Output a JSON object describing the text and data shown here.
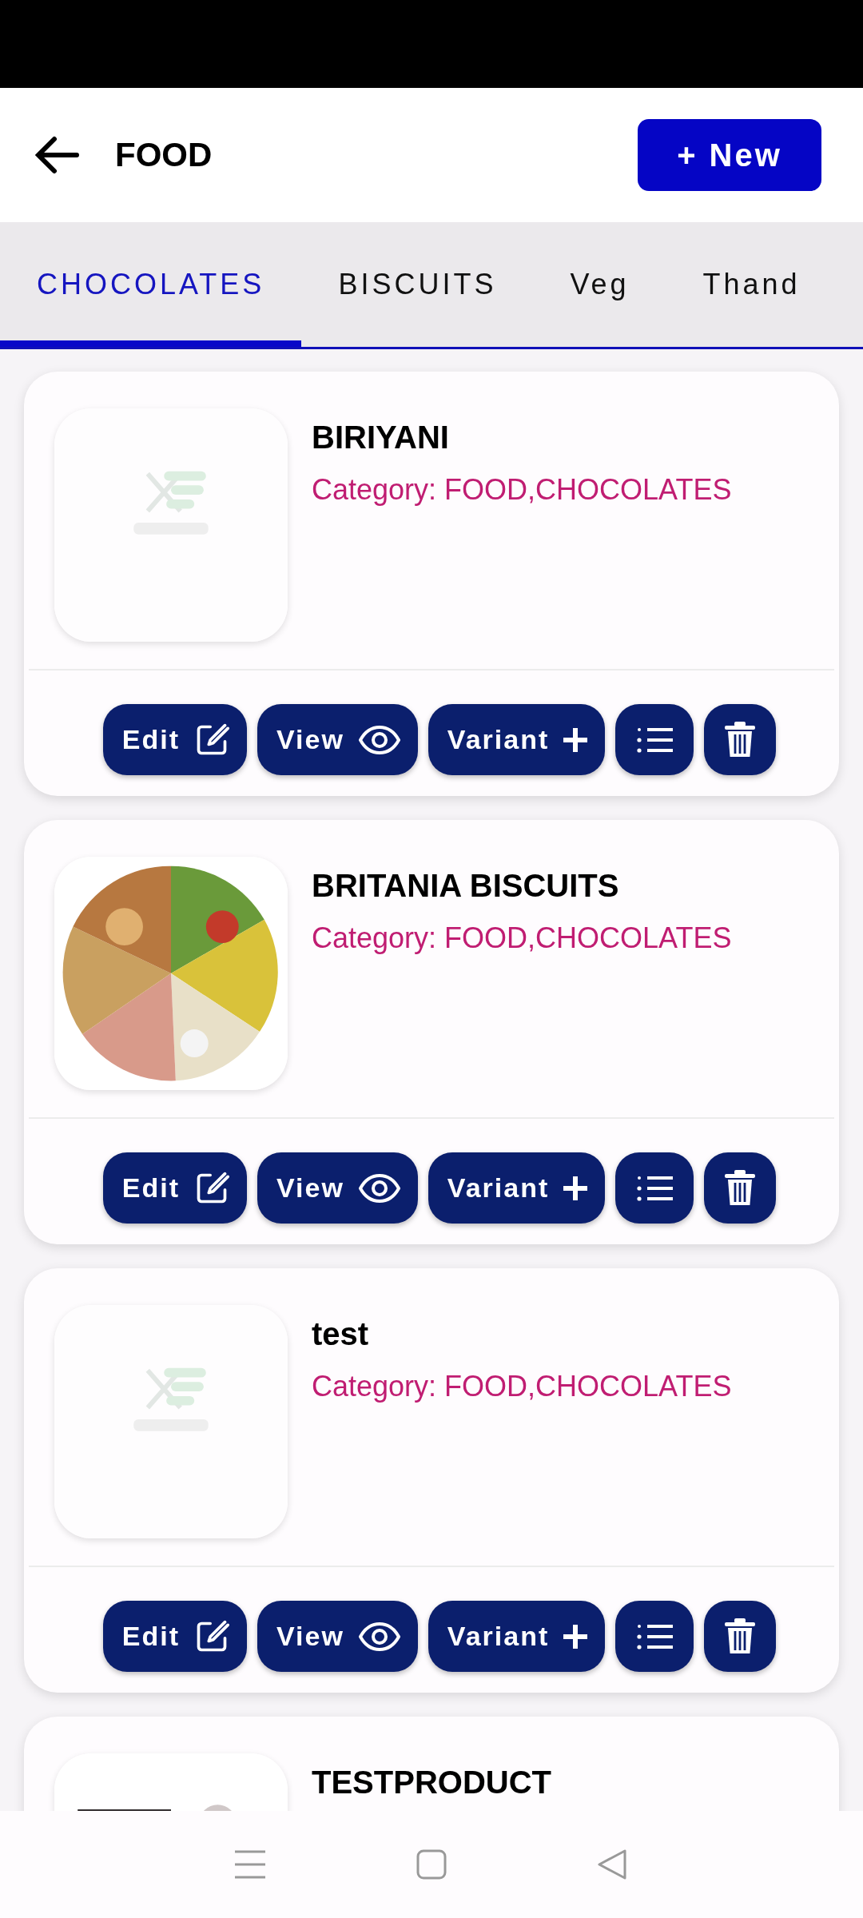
{
  "header": {
    "title": "FOOD",
    "new_button": "+ New"
  },
  "tabs": [
    {
      "label": "CHOCOLATES",
      "selected": true
    },
    {
      "label": "BISCUITS",
      "selected": false
    },
    {
      "label": "Veg",
      "selected": false
    },
    {
      "label": "Thand",
      "selected": false
    }
  ],
  "products": [
    {
      "name": "BIRIYANI",
      "category": "Category: FOOD,CHOCOLATES",
      "image": {
        "kind": "placeholder"
      },
      "actions": [
        {
          "kind": "edit",
          "label": "Edit"
        },
        {
          "kind": "view",
          "label": "View"
        },
        {
          "kind": "variant",
          "label": "Variant"
        },
        {
          "kind": "list"
        },
        {
          "kind": "delete"
        }
      ]
    },
    {
      "name": "BRITANIA BISCUITS",
      "category": "Category: FOOD,CHOCOLATES",
      "actions": [
        {
          "kind": "edit",
          "label": "Edit"
        },
        {
          "kind": "view",
          "label": "View"
        },
        {
          "kind": "variant",
          "label": "Variant"
        },
        {
          "kind": "list"
        },
        {
          "kind": "delete"
        }
      ]
    },
    {
      "name": "test",
      "category": "Category: FOOD,CHOCOLATES",
      "image": {
        "kind": "placeholder"
      },
      "actions": [
        {
          "kind": "edit",
          "label": "Edit"
        },
        {
          "kind": "view",
          "label": "View"
        },
        {
          "kind": "variant",
          "label": "Variant"
        },
        {
          "kind": "list"
        },
        {
          "kind": "delete"
        }
      ]
    },
    {
      "name": "TESTPRODUCT"
    }
  ]
}
